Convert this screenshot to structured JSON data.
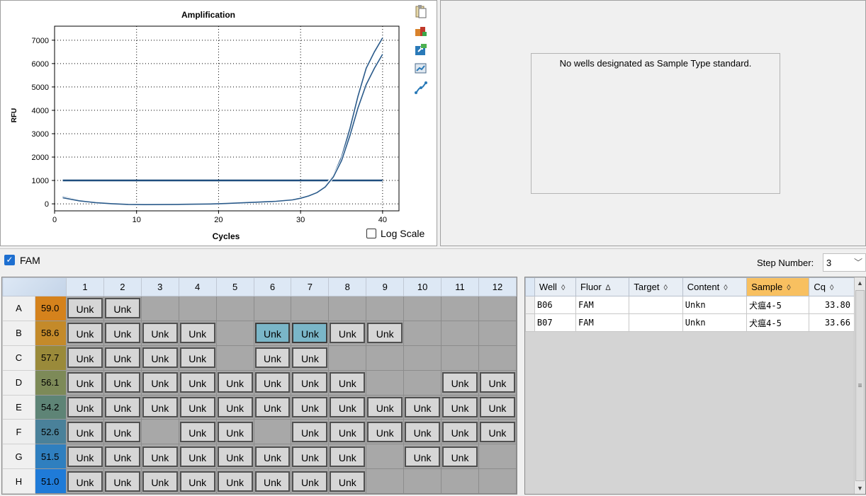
{
  "chart": {
    "title": "Amplification",
    "log_scale_label": "Log Scale",
    "toolbar_icons": [
      "copy-icon",
      "plate-icon",
      "export-icon",
      "zoom-chart-icon",
      "curve-settings-icon"
    ]
  },
  "chart_data": {
    "type": "line",
    "title": "Amplification",
    "xlabel": "Cycles",
    "ylabel": "RFU",
    "xlim": [
      0,
      42
    ],
    "ylim": [
      -300,
      7600
    ],
    "xticks": [
      0,
      10,
      20,
      30,
      40
    ],
    "yticks": [
      0,
      1000,
      2000,
      3000,
      4000,
      5000,
      6000,
      7000
    ],
    "grid": true,
    "threshold": 1000,
    "series": [
      {
        "x": [
          1,
          3,
          5,
          7,
          9,
          11,
          13,
          15,
          17,
          19,
          21,
          23,
          25,
          27,
          29,
          30,
          31,
          32,
          33,
          34,
          35,
          36,
          37,
          38,
          39,
          40
        ],
        "y": [
          300,
          150,
          60,
          10,
          -20,
          -30,
          -25,
          -20,
          -10,
          0,
          20,
          50,
          80,
          120,
          180,
          250,
          350,
          500,
          750,
          1200,
          2000,
          3200,
          4600,
          5800,
          6500,
          7100
        ]
      },
      {
        "x": [
          1,
          3,
          5,
          7,
          9,
          11,
          13,
          15,
          17,
          19,
          21,
          23,
          25,
          27,
          29,
          30,
          31,
          32,
          33,
          34,
          35,
          36,
          37,
          38,
          39,
          40
        ],
        "y": [
          260,
          130,
          50,
          5,
          -25,
          -35,
          -30,
          -25,
          -15,
          -5,
          15,
          45,
          75,
          110,
          170,
          240,
          340,
          480,
          720,
          1150,
          1850,
          2900,
          4100,
          5100,
          5800,
          6400
        ]
      }
    ]
  },
  "standard": {
    "message": "No wells designated as Sample Type standard."
  },
  "fluor": {
    "label": "FAM",
    "step_label": "Step Number:",
    "step_value": "3"
  },
  "plate": {
    "columns": [
      "1",
      "2",
      "3",
      "4",
      "5",
      "6",
      "7",
      "8",
      "9",
      "10",
      "11",
      "12"
    ],
    "rows": [
      {
        "label": "A",
        "temp": "59.0",
        "color": "#d5821c",
        "wells": [
          "Unk",
          "Unk",
          "",
          "",
          "",
          "",
          "",
          "",
          "",
          "",
          "",
          ""
        ]
      },
      {
        "label": "B",
        "temp": "58.6",
        "color": "#c48a2a",
        "wells": [
          "Unk",
          "Unk",
          "Unk",
          "Unk",
          "",
          "Unk",
          "Unk",
          "Unk",
          "Unk",
          "",
          "",
          ""
        ]
      },
      {
        "label": "C",
        "temp": "57.7",
        "color": "#9a8a3a",
        "wells": [
          "Unk",
          "Unk",
          "Unk",
          "Unk",
          "",
          "Unk",
          "Unk",
          "",
          "",
          "",
          "",
          ""
        ]
      },
      {
        "label": "D",
        "temp": "56.1",
        "color": "#7d8a58",
        "wells": [
          "Unk",
          "Unk",
          "Unk",
          "Unk",
          "Unk",
          "Unk",
          "Unk",
          "Unk",
          "",
          "",
          "Unk",
          "Unk"
        ]
      },
      {
        "label": "E",
        "temp": "54.2",
        "color": "#5e8476",
        "wells": [
          "Unk",
          "Unk",
          "Unk",
          "Unk",
          "Unk",
          "Unk",
          "Unk",
          "Unk",
          "Unk",
          "Unk",
          "Unk",
          "Unk"
        ]
      },
      {
        "label": "F",
        "temp": "52.6",
        "color": "#4a819a",
        "wells": [
          "Unk",
          "Unk",
          "",
          "Unk",
          "Unk",
          "",
          "Unk",
          "Unk",
          "Unk",
          "Unk",
          "Unk",
          "Unk"
        ]
      },
      {
        "label": "G",
        "temp": "51.5",
        "color": "#2f7fbf",
        "wells": [
          "Unk",
          "Unk",
          "Unk",
          "Unk",
          "Unk",
          "Unk",
          "Unk",
          "Unk",
          "",
          "Unk",
          "Unk",
          ""
        ]
      },
      {
        "label": "H",
        "temp": "51.0",
        "color": "#1f7bd8",
        "wells": [
          "Unk",
          "Unk",
          "Unk",
          "Unk",
          "Unk",
          "Unk",
          "Unk",
          "Unk",
          "",
          "",
          "",
          ""
        ]
      }
    ],
    "selected": [
      "B6",
      "B7"
    ]
  },
  "results": {
    "headers": [
      {
        "label": "Well",
        "sort": "◊"
      },
      {
        "label": "Fluor",
        "sort": "∆"
      },
      {
        "label": "Target",
        "sort": "◊"
      },
      {
        "label": "Content",
        "sort": "◊"
      },
      {
        "label": "Sample",
        "sort": "◊"
      },
      {
        "label": "Cq",
        "sort": "◊"
      }
    ],
    "rows": [
      {
        "well": "B06",
        "fluor": "FAM",
        "target": "",
        "content": "Unkn",
        "sample": "犬瘟4-5",
        "cq": "33.80"
      },
      {
        "well": "B07",
        "fluor": "FAM",
        "target": "",
        "content": "Unkn",
        "sample": "犬瘟4-5",
        "cq": "33.66"
      }
    ]
  },
  "colors": {
    "curve": "#2a5a8a",
    "threshold": "#1f4e7e",
    "selected_well": "#7ab6c8",
    "sample_header": "#f8c060"
  }
}
